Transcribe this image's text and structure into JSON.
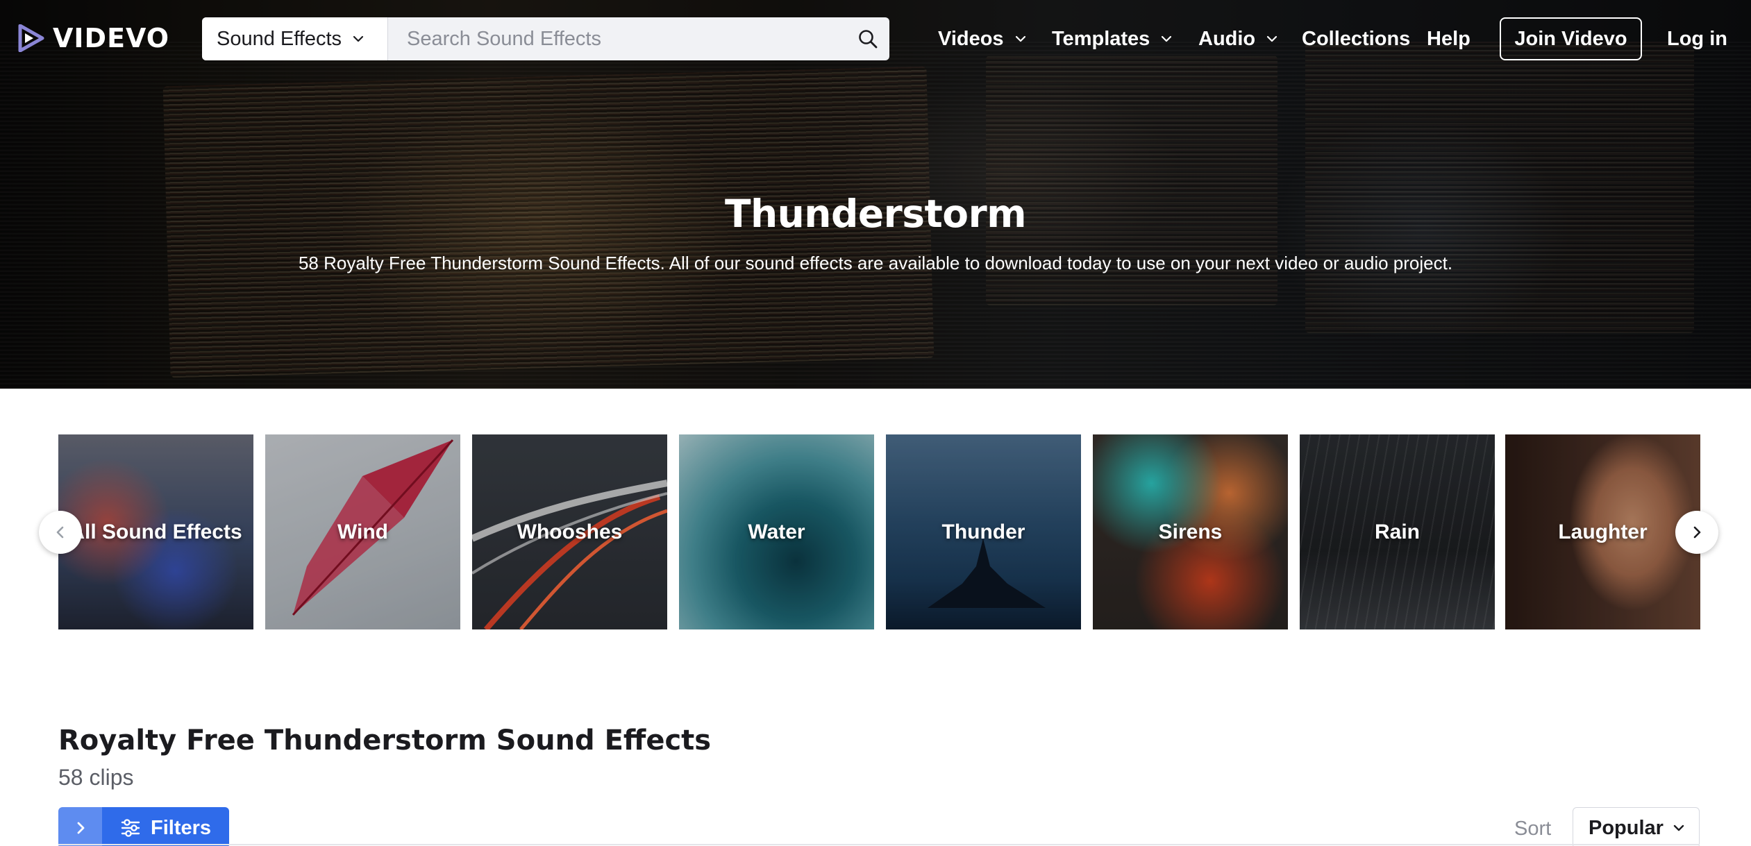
{
  "brand": {
    "name": "VIDEVO",
    "accent": "#2f6bea",
    "logo_color": "#8b86d6"
  },
  "search": {
    "type_selected": "Sound Effects",
    "placeholder": "Search Sound Effects",
    "value": ""
  },
  "nav": {
    "items": [
      {
        "label": "Videos",
        "has_dropdown": true
      },
      {
        "label": "Templates",
        "has_dropdown": true
      },
      {
        "label": "Audio",
        "has_dropdown": true
      },
      {
        "label": "Collections",
        "has_dropdown": false
      },
      {
        "label": "Help",
        "has_dropdown": false
      }
    ],
    "join_label": "Join Videvo",
    "login_label": "Log in"
  },
  "hero": {
    "title": "Thunderstorm",
    "subtitle": "58 Royalty Free Thunderstorm Sound Effects. All of our sound effects are available to download today to use on your next video or audio project."
  },
  "categories": [
    {
      "label": "All Sound Effects",
      "color": "#3c4b6a"
    },
    {
      "label": "Wind",
      "color": "#b9bfc5"
    },
    {
      "label": "Whooshes",
      "color": "#2a2d33"
    },
    {
      "label": "Water",
      "color": "#1e6a78"
    },
    {
      "label": "Thunder",
      "color": "#1b3b5a"
    },
    {
      "label": "Sirens",
      "color": "#2a2522"
    },
    {
      "label": "Rain",
      "color": "#1d1f22"
    },
    {
      "label": "Laughter",
      "color": "#4a3026"
    }
  ],
  "listing": {
    "title": "Royalty Free Thunderstorm Sound Effects",
    "count": "58 clips",
    "filters_label": "Filters",
    "sort_label": "Sort",
    "sort_value": "Popular"
  },
  "icons": [
    "logo-play-icon",
    "chevron-down-icon",
    "search-icon",
    "chevron-left-icon",
    "chevron-right-icon",
    "sliders-icon"
  ]
}
